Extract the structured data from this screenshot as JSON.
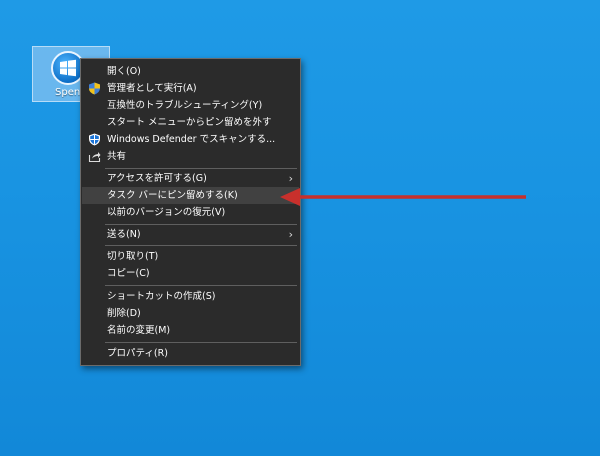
{
  "desktop_icon": {
    "label": "Spenc"
  },
  "context_menu": {
    "groups": [
      {
        "items": [
          {
            "label": "開く(O)",
            "icon": "",
            "submenu": false
          },
          {
            "label": "管理者として実行(A)",
            "icon": "uac-shield-icon",
            "submenu": false
          },
          {
            "label": "互換性のトラブルシューティング(Y)",
            "icon": "",
            "submenu": false
          },
          {
            "label": "スタート メニューからピン留めを外す",
            "icon": "",
            "submenu": false
          },
          {
            "label": "Windows Defender でスキャンする...",
            "icon": "defender-shield-icon",
            "submenu": false
          },
          {
            "label": "共有",
            "icon": "share-icon",
            "submenu": false
          }
        ]
      },
      {
        "items": [
          {
            "label": "アクセスを許可する(G)",
            "icon": "",
            "submenu": true
          },
          {
            "label": "タスク バーにピン留めする(K)",
            "icon": "",
            "submenu": false,
            "highlighted": true
          },
          {
            "label": "以前のバージョンの復元(V)",
            "icon": "",
            "submenu": false
          }
        ]
      },
      {
        "items": [
          {
            "label": "送る(N)",
            "icon": "",
            "submenu": true
          }
        ]
      },
      {
        "items": [
          {
            "label": "切り取り(T)",
            "icon": "",
            "submenu": false
          },
          {
            "label": "コピー(C)",
            "icon": "",
            "submenu": false
          }
        ]
      },
      {
        "items": [
          {
            "label": "ショートカットの作成(S)",
            "icon": "",
            "submenu": false
          },
          {
            "label": "削除(D)",
            "icon": "",
            "submenu": false
          },
          {
            "label": "名前の変更(M)",
            "icon": "",
            "submenu": false
          }
        ]
      },
      {
        "items": [
          {
            "label": "プロパティ(R)",
            "icon": "",
            "submenu": false
          }
        ]
      }
    ]
  },
  "colors": {
    "desktop": "#1994e2",
    "menu_bg": "#2b2b2b",
    "menu_highlight": "#414141",
    "annotation_arrow": "#c8302c"
  }
}
